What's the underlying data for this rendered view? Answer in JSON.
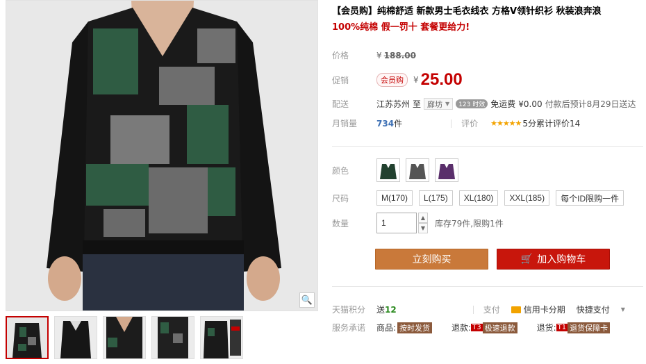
{
  "product": {
    "title": "【会员购】纯棉舒适 新款男士毛衣线衣 方格V领针织衫 秋装浪奔浪",
    "subtitle": "100%纯棉 假一罚十 套餐更给力!"
  },
  "price": {
    "label": "价格",
    "currency": "¥",
    "original": "188.00",
    "promo_label": "促销",
    "vip_tag": "会员购",
    "current": "25.00"
  },
  "delivery": {
    "label": "配送",
    "from": "江苏苏州",
    "to_word": "至",
    "destination": "廊坊",
    "hours_badge": "123 时效",
    "free_shipping": "免运费",
    "fee": "¥0.00",
    "eta": "付款后预计8月29日送达"
  },
  "sales": {
    "label": "月销量",
    "count": "734",
    "unit": "件",
    "rating_label": "评价",
    "stars": "★★★★★",
    "rating_text": "5分累计评价14"
  },
  "colors": {
    "label": "颜色"
  },
  "sizes": {
    "label": "尺码",
    "options": [
      "M(170)",
      "L(175)",
      "XL(180)",
      "XXL(185)",
      "每个ID限购一件"
    ]
  },
  "quantity": {
    "label": "数量",
    "value": "1",
    "stock_text": "库存79件,限购1件"
  },
  "actions": {
    "buy_now": "立刻购买",
    "add_cart": "加入购物车"
  },
  "points": {
    "label": "天猫积分",
    "send": "送",
    "value": "12",
    "pay_label": "支付",
    "card_installment": "信用卡分期",
    "quick_pay": "快捷支付"
  },
  "service": {
    "label": "服务承诺",
    "goods": "商品:",
    "goods_tag": "按时发货",
    "refund": "退款:",
    "refund_t": "T3",
    "refund_tag": "极速退款",
    "return": "退货:",
    "return_t": "T1",
    "return_tag": "退货保障卡"
  },
  "icons": [
    "zoom-icon",
    "cart-icon",
    "card-icon",
    "star-icon"
  ]
}
